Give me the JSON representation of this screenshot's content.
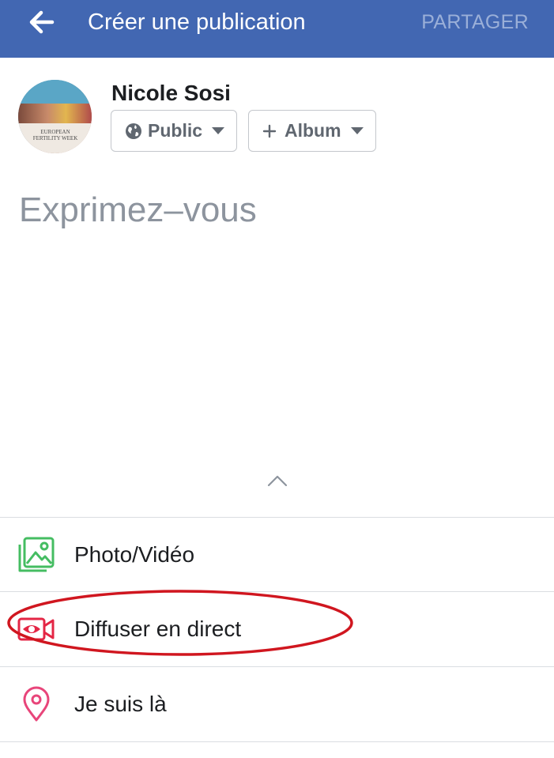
{
  "header": {
    "title": "Créer une publication",
    "share_label": "PARTAGER",
    "back_icon": "arrow-left-icon",
    "background_color": "#4267b2"
  },
  "composer": {
    "user_name": "Nicole Sosi",
    "avatar_caption": "EUROPEAN FERTILITY WEEK",
    "privacy_label": "Public",
    "privacy_icon": "globe-icon",
    "album_label": "Album",
    "album_icon": "plus-icon",
    "placeholder": "Exprimez–vous"
  },
  "actions": [
    {
      "label": "Photo/Vidéo",
      "icon": "photo-icon",
      "color": "#45bd62"
    },
    {
      "label": "Diffuser en direct",
      "icon": "live-video-icon",
      "color": "#e42645"
    },
    {
      "label": "Je suis là",
      "icon": "location-pin-icon",
      "color": "#e8457a"
    }
  ],
  "annotation": {
    "shape": "ellipse",
    "color": "#d0161f",
    "target": "Diffuser en direct"
  }
}
